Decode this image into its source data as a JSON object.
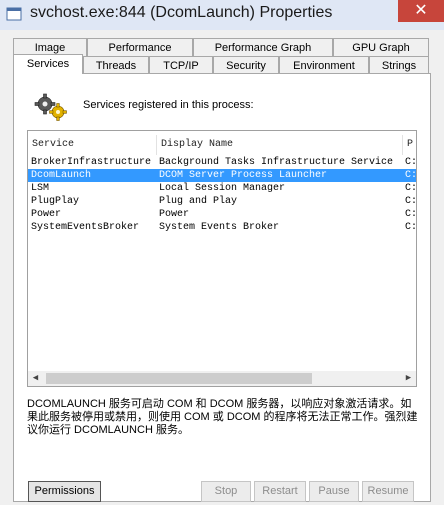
{
  "window": {
    "title": "svchost.exe:844 (DcomLaunch) Properties",
    "close_glyph": "✕",
    "icon": "app-window-icon"
  },
  "tabs_row1": [
    "Image",
    "Performance",
    "Performance Graph",
    "GPU Graph"
  ],
  "tabs_row2": [
    "Services",
    "Threads",
    "TCP/IP",
    "Security",
    "Environment",
    "Strings"
  ],
  "active_tab": "Services",
  "intro_text": "Services registered in this process:",
  "intro_icon": "gears-icon",
  "list": {
    "columns": [
      "Service",
      "Display Name",
      "P"
    ],
    "rows": [
      {
        "service": "BrokerInfrastructure",
        "display": "Background Tasks Infrastructure Service",
        "path": "C:"
      },
      {
        "service": "DcomLaunch",
        "display": "DCOM Server Process Launcher",
        "path": "C:"
      },
      {
        "service": "LSM",
        "display": "Local Session Manager",
        "path": "C:"
      },
      {
        "service": "PlugPlay",
        "display": "Plug and Play",
        "path": "C:"
      },
      {
        "service": "Power",
        "display": "Power",
        "path": "C:"
      },
      {
        "service": "SystemEventsBroker",
        "display": "System Events Broker",
        "path": "C:"
      }
    ],
    "selected_row": 1
  },
  "description": "DCOMLAUNCH 服务可启动 COM 和 DCOM 服务器，以响应对象激活请求。如果此服务被停用或禁用，则使用 COM 或 DCOM 的程序将无法正常工作。强烈建议你运行 DCOMLAUNCH 服务。",
  "buttons": {
    "permissions": "Permissions",
    "stop": "Stop",
    "restart": "Restart",
    "pause": "Pause",
    "resume": "Resume"
  },
  "colors": {
    "selection": "#3399ff",
    "close_button": "#c7453b",
    "titlebar": "#dfe7f5"
  }
}
